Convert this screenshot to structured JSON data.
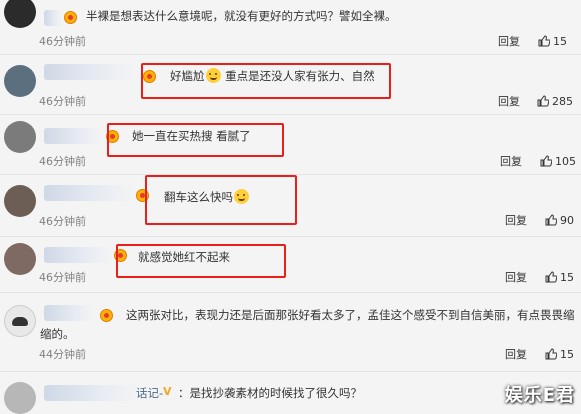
{
  "comments": [
    {
      "text": "半裸是想表达什么意境呢，就没有更好的方式吗？譬如全裸。",
      "time": "46分钟前",
      "reply": "回复",
      "likes": "15"
    },
    {
      "text": "好尴尬",
      "text2": "重点是还没人家有张力、自然",
      "time": "46分钟前",
      "reply": "回复",
      "likes": "285"
    },
    {
      "text": "她一直在买热搜 看腻了",
      "time": "46分钟前",
      "reply": "回复",
      "likes": "105"
    },
    {
      "text": "翻车这么快吗",
      "time": "46分钟前",
      "reply": "回复",
      "likes": "90"
    },
    {
      "text": "就感觉她红不起来",
      "time": "46分钟前",
      "reply": "回复",
      "likes": "15"
    },
    {
      "text": "这两张对比，表现力还是后面那张好看太多了，孟佳这个感受不到自信美丽，有点畏畏缩",
      "text_line2": "缩的。",
      "time": "44分钟前",
      "reply": "回复",
      "likes": "15"
    },
    {
      "name_fragment": "话记-",
      "text": "是找抄袭素材的时候找了很久吗？"
    }
  ],
  "watermark": "娱乐E君",
  "colors": {
    "highlight_box": "#e8201c",
    "meta_gray": "#808080"
  },
  "icons": {
    "like": "thumbs-up-icon",
    "member": "member-badge-icon",
    "emoji": "emoji-icon"
  }
}
